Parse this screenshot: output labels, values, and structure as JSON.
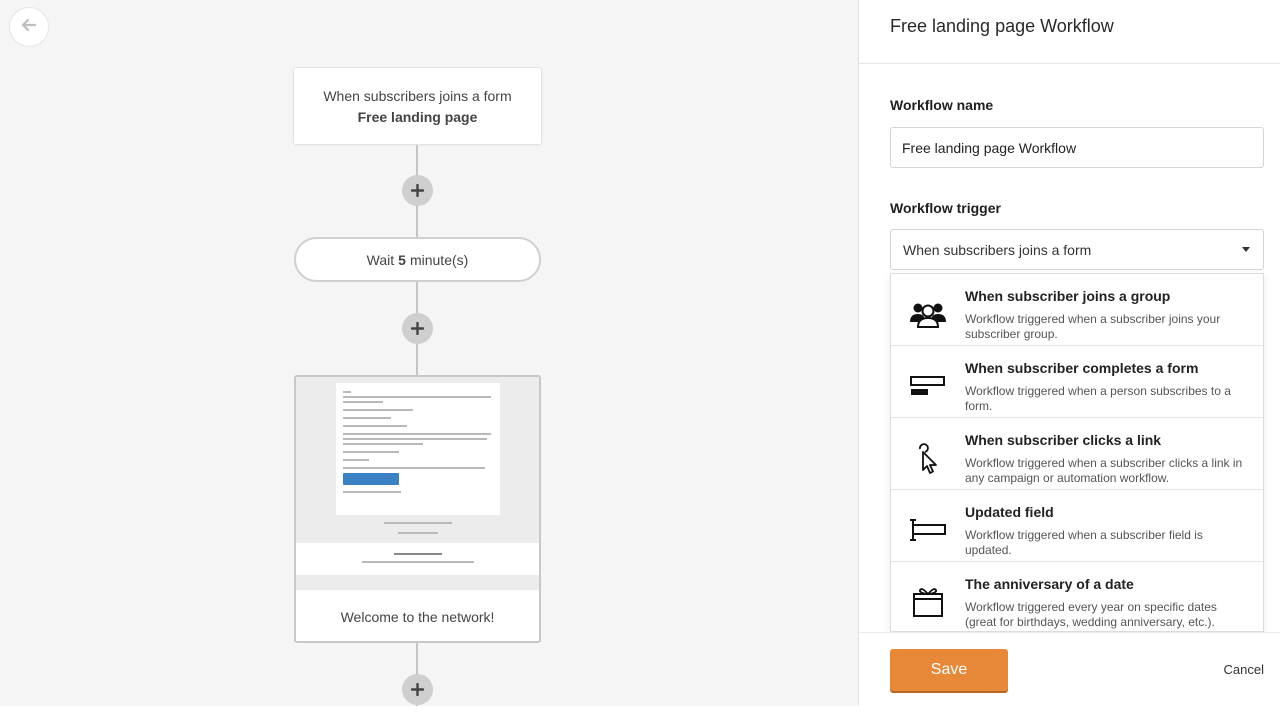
{
  "canvas": {
    "trigger": {
      "line1": "When subscribers joins a form",
      "line2": "Free landing page"
    },
    "wait": {
      "prefix": "Wait",
      "value": "5",
      "suffix": "minute(s)"
    },
    "email": {
      "caption": "Welcome to the network!"
    }
  },
  "panel": {
    "title": "Free landing page Workflow",
    "name_label": "Workflow name",
    "name_value": "Free landing page Workflow",
    "trigger_label": "Workflow trigger",
    "trigger_selected": "When subscribers joins a form",
    "options": [
      {
        "title": "When subscriber joins a group",
        "desc": "Workflow triggered when a subscriber joins your subscriber group.",
        "icon": "group-icon"
      },
      {
        "title": "When subscriber completes a form",
        "desc": "Workflow triggered when a person subscribes to a form.",
        "icon": "form-icon"
      },
      {
        "title": "When subscriber clicks a link",
        "desc": "Workflow triggered when a subscriber clicks a link in any campaign or automation workflow.",
        "icon": "cursor-click-icon"
      },
      {
        "title": "Updated field",
        "desc": "Workflow triggered when a subscriber field is updated.",
        "icon": "text-field-icon"
      },
      {
        "title": "The anniversary of a date",
        "desc": "Workflow triggered every year on specific dates (great for birthdays, wedding anniversary, etc.).",
        "icon": "gift-icon"
      }
    ],
    "save_label": "Save",
    "cancel_label": "Cancel"
  },
  "colors": {
    "accent": "#e8893a",
    "connector": "#c4c4c4",
    "plus_bg": "#cfcfcf"
  }
}
